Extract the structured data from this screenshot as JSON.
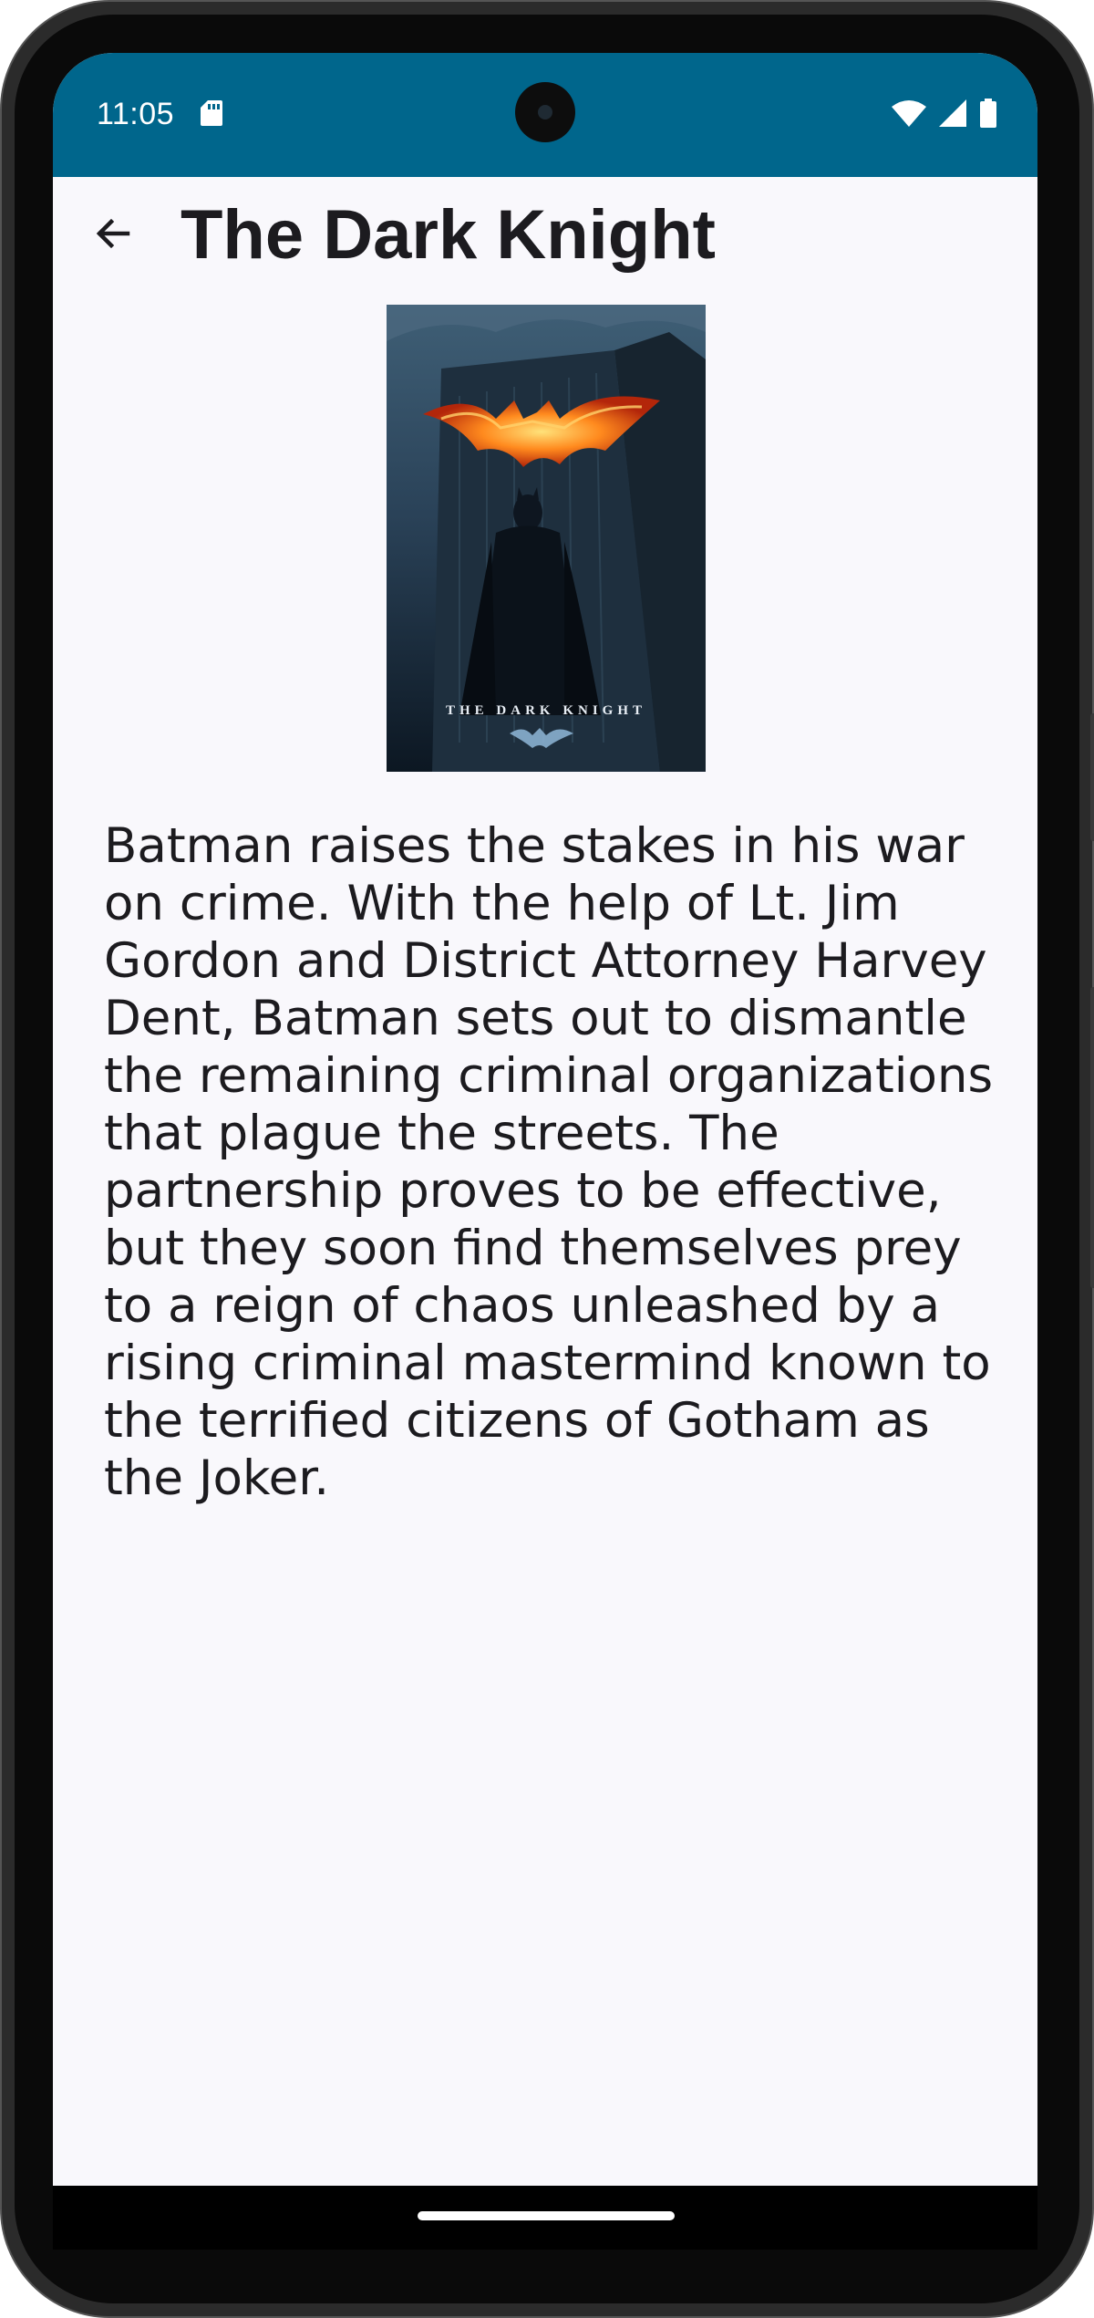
{
  "status_bar": {
    "time": "11:05",
    "icons": [
      "sd-card-icon",
      "wifi-icon",
      "cellular-signal-icon",
      "battery-icon"
    ],
    "background_color": "#00668c"
  },
  "app_bar": {
    "back_icon": "arrow-back-icon",
    "title": "The Dark Knight"
  },
  "poster": {
    "caption": "THE DARK KNIGHT",
    "image_subject": "batman-poster"
  },
  "description": "Batman raises the stakes in his war on crime. With the help of Lt. Jim Gordon and District Attorney Harvey Dent, Batman sets out to dismantle the remaining criminal organizations that plague the streets. The partnership proves to be effective, but they soon find themselves prey to a reign of chaos unleashed by a rising criminal mastermind known to the terrified citizens of Gotham as the Joker.",
  "colors": {
    "screen_background": "#f9f8fc",
    "text": "#1c1b1f"
  }
}
